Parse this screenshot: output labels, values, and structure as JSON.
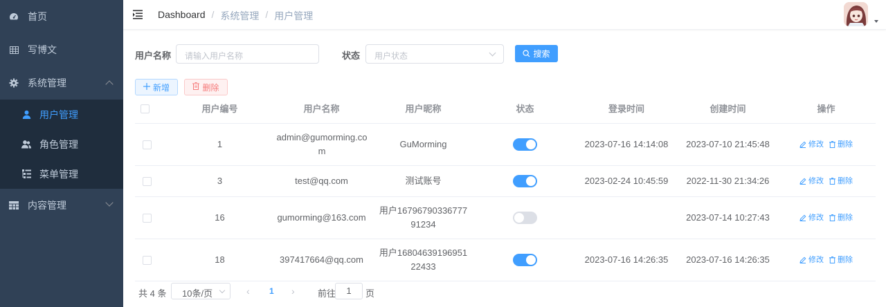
{
  "sidebar": {
    "items": [
      {
        "label": "首页",
        "icon": "dashboard-icon"
      },
      {
        "label": "写博文",
        "icon": "table-icon"
      },
      {
        "label": "系统管理",
        "icon": "gear-icon",
        "expanded": true
      },
      {
        "label": "内容管理",
        "icon": "grid-icon",
        "expanded": false
      }
    ],
    "submenu": [
      {
        "label": "用户管理",
        "icon": "user-icon",
        "active": true
      },
      {
        "label": "角色管理",
        "icon": "users-icon",
        "active": false
      },
      {
        "label": "菜单管理",
        "icon": "list-icon",
        "active": false
      }
    ],
    "colors": {
      "bg": "#304156",
      "submenu_bg": "#1f2d3d",
      "active": "#409eff"
    }
  },
  "navbar": {
    "breadcrumb": [
      "Dashboard",
      "系统管理",
      "用户管理"
    ]
  },
  "search": {
    "username_label": "用户名称",
    "username_placeholder": "请输入用户名称",
    "status_label": "状态",
    "status_placeholder": "用户状态",
    "search_button": "搜索"
  },
  "actions": {
    "add_label": "新增",
    "delete_label": "删除"
  },
  "table": {
    "columns": [
      "用户编号",
      "用户名称",
      "用户昵称",
      "状态",
      "登录时间",
      "创建时间",
      "操作"
    ],
    "rows": [
      {
        "id": "1",
        "username": "admin@gumorming.com",
        "nickname": "GuMorming",
        "enabled": true,
        "login_time": "2023-07-16 14:14:08",
        "create_time": "2023-07-10 21:45:48"
      },
      {
        "id": "3",
        "username": "test@qq.com",
        "nickname": "测试账号",
        "enabled": true,
        "login_time": "2023-02-24 10:45:59",
        "create_time": "2022-11-30 21:34:26"
      },
      {
        "id": "16",
        "username": "gumorming@163.com",
        "nickname": "用户1679679033677791234",
        "enabled": false,
        "login_time": "",
        "create_time": "2023-07-14 10:27:43"
      },
      {
        "id": "18",
        "username": "397417664@qq.com",
        "nickname": "用户1680463919695122433",
        "enabled": true,
        "login_time": "2023-07-16 14:26:35",
        "create_time": "2023-07-16 14:26:35"
      }
    ],
    "edit_label": "修改",
    "delete_label": "删除"
  },
  "pagination": {
    "total": "共 4 条",
    "page_size": "10条/页",
    "current_page": "1",
    "goto_label": "前往",
    "goto_value": "1",
    "page_suffix": "页"
  }
}
